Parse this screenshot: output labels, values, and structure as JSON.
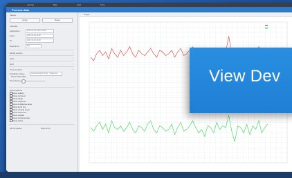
{
  "menubar": {
    "items": [
      "Journal",
      "Misc",
      "Font",
      "Time"
    ]
  },
  "titlebar": {
    "title": "Process data"
  },
  "sidebar": {
    "section_title": "Values",
    "btn_left": "Apply",
    "btn_right": "Reset",
    "group_label": "Formula",
    "fields": [
      {
        "label": "Application",
        "value": "2017-01-01 / 2017-12-31"
      },
      {
        "label": "From",
        "value": "2017-01-01 10:00"
      },
      {
        "label": "To",
        "value": "2017-12-31 12:00"
      },
      {
        "label": "Expand to",
        "value": "Day"
      }
    ],
    "collapsibles": [
      "Model options",
      "Style",
      "Grid",
      "Process data"
    ],
    "compare_label": "Visualize values",
    "compare_value": "Custom Design Show · Target line",
    "show_text": "Show data table",
    "smoothing_label": "Smoothing",
    "checklist_title": "Show options",
    "checklist": [
      "Show outliers",
      "Show minimum",
      "Show range",
      "Show maximum",
      "Show confidence area",
      "Show trend line",
      "Show running mean",
      "Show mean line",
      "Show median",
      "Show minimum/max",
      "Show points"
    ],
    "footer_left": "All computed",
    "footer_right": "Export csv"
  },
  "plot": {
    "tab_label": "Graph"
  },
  "cta": {
    "label": "View Dev"
  },
  "colors": {
    "series_red": "#d9534f",
    "series_green": "#4cd964",
    "accent": "#2a8fe0"
  },
  "chart_data": {
    "type": "line",
    "legend": "top-right",
    "grid": true,
    "series": [
      {
        "color": "#d9534f",
        "values": [
          70,
          68,
          72,
          74,
          71,
          73,
          69,
          75,
          72,
          70,
          74,
          71,
          73,
          76,
          72,
          70,
          74,
          72,
          71,
          73,
          75,
          72,
          70,
          74,
          73,
          71,
          72,
          74,
          70,
          73,
          75,
          71,
          72,
          74,
          76,
          73,
          71,
          72,
          70,
          74,
          73,
          71,
          75,
          72,
          74,
          73,
          82,
          72,
          71,
          74,
          73,
          72,
          75,
          71,
          74,
          73,
          76,
          72,
          74,
          75
        ]
      },
      {
        "color": "#4cd964",
        "values": [
          30,
          28,
          31,
          33,
          29,
          32,
          27,
          34,
          30,
          29,
          31,
          28,
          30,
          33,
          29,
          27,
          31,
          30,
          28,
          32,
          34,
          29,
          27,
          31,
          30,
          28,
          29,
          32,
          26,
          30,
          33,
          28,
          29,
          31,
          34,
          30,
          27,
          29,
          25,
          31,
          30,
          27,
          33,
          29,
          31,
          30,
          37,
          28,
          22,
          31,
          30,
          27,
          32,
          26,
          31,
          29,
          34,
          27,
          30,
          32
        ]
      }
    ]
  }
}
